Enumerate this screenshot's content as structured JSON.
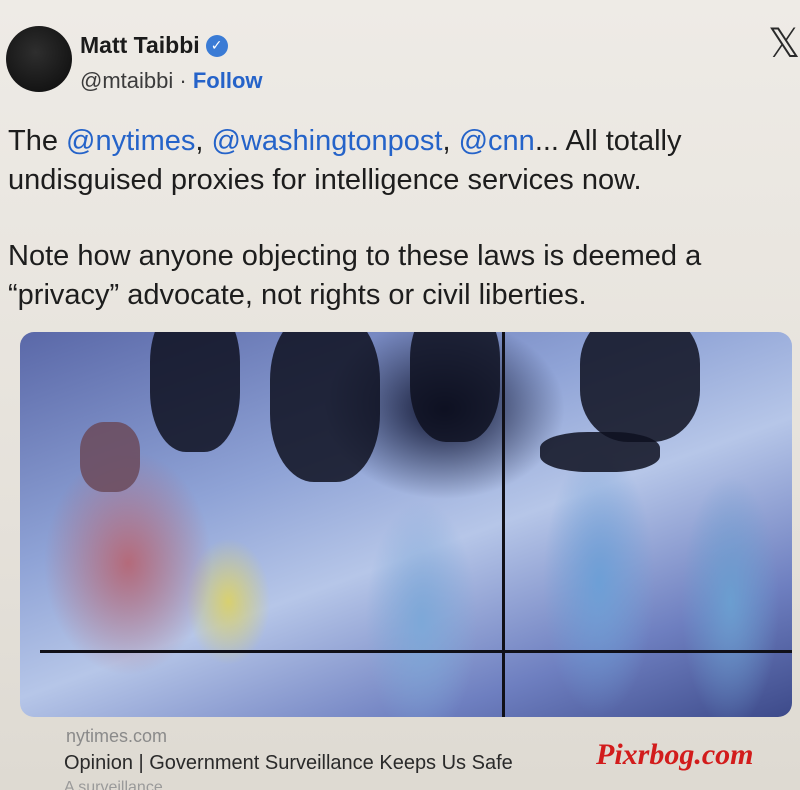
{
  "author": {
    "name": "Matt Taibbi",
    "handle": "@mtaibbi",
    "separator": "·",
    "follow_label": "Follow",
    "verified_icon": "verified-badge-icon"
  },
  "platform_icon": "x-logo-icon",
  "tweet": {
    "p1_prefix": "The ",
    "mention_1": "@nytimes",
    "sep_1": ", ",
    "mention_2": "@washingtonpost",
    "sep_2": ", ",
    "mention_3": "@cnn",
    "p1_suffix": "... All totally undisguised proxies for intelligence services now.",
    "p2": "Note how anyone objecting to these laws is deemed a “privacy” advocate, not rights or civil liberties."
  },
  "card": {
    "domain": "nytimes.com",
    "headline": "Opinion | Government Surveillance Keeps Us Safe",
    "subline": "A surveillance"
  },
  "watermark": "Pixrbog.com",
  "colors": {
    "link": "#2563c9",
    "verified": "#3a7bd5",
    "watermark": "#d21c1c"
  }
}
